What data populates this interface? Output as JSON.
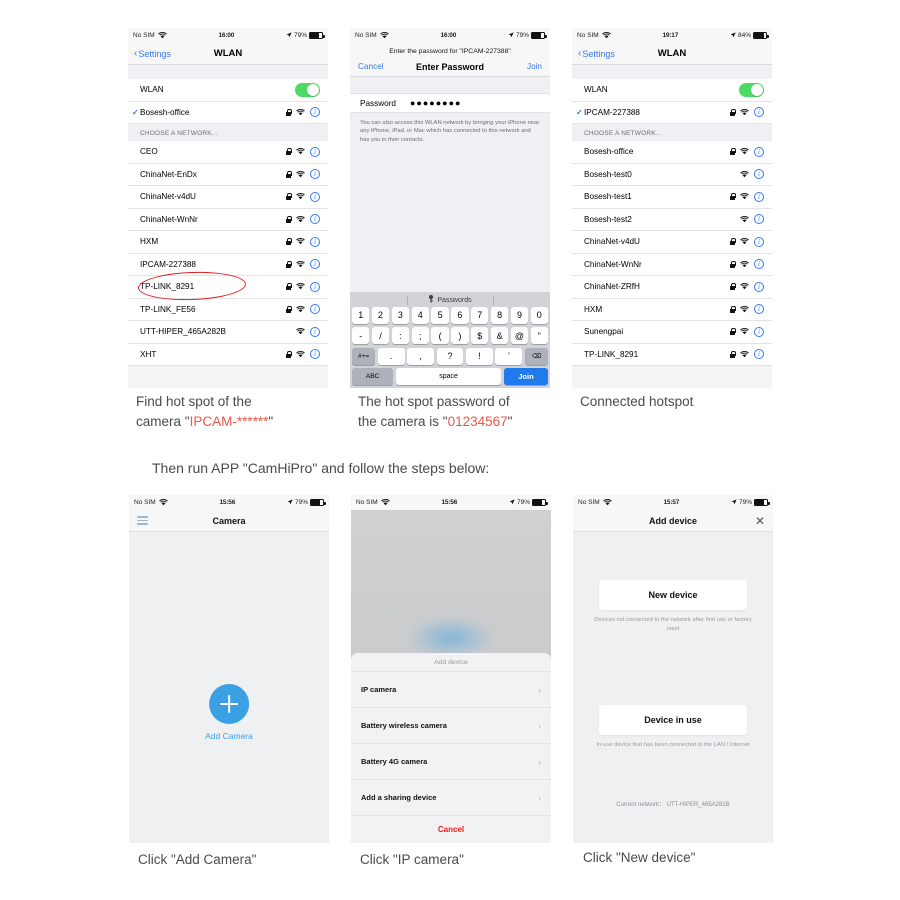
{
  "phones": {
    "wlan_list": {
      "statusbar": {
        "carrier": "No SIM",
        "time": "16:00",
        "battery_text": "79%"
      },
      "nav": {
        "back": "Settings",
        "title": "WLAN"
      },
      "wlan_row_label": "WLAN",
      "connected_network": "Bosesh-office",
      "section_header": "CHOOSE A NETWORK...",
      "networks": [
        {
          "name": "CEO",
          "locked": true
        },
        {
          "name": "ChinaNet-EnDx",
          "locked": true
        },
        {
          "name": "ChinaNet-v4dU",
          "locked": true
        },
        {
          "name": "ChinaNet-WnNr",
          "locked": true
        },
        {
          "name": "HXM",
          "locked": true
        },
        {
          "name": "IPCAM-227388",
          "locked": true
        },
        {
          "name": "TP-LINK_8291",
          "locked": true
        },
        {
          "name": "TP-LINK_FE56",
          "locked": true
        },
        {
          "name": "UTT-HIPER_465A282B",
          "locked": false
        },
        {
          "name": "XHT",
          "locked": true
        }
      ]
    },
    "password": {
      "statusbar": {
        "carrier": "No SIM",
        "time": "16:00",
        "battery_text": "79%"
      },
      "prompt": "Enter the password for \"IPCAM-227388\"",
      "bar": {
        "cancel": "Cancel",
        "title": "Enter Password",
        "join": "Join"
      },
      "field": {
        "label": "Password",
        "value": "●●●●●●●●"
      },
      "note": "You can also access this WLAN network by bringing your iPhone near any iPhone, iPad, or Mac which has connected to this network and has you in their contacts.",
      "keyboard": {
        "suggestion": "Passwords",
        "row1": [
          "1",
          "2",
          "3",
          "4",
          "5",
          "6",
          "7",
          "8",
          "9",
          "0"
        ],
        "row2": [
          "-",
          "/",
          ":",
          ";",
          "(",
          ")",
          "$",
          "&",
          "@",
          "”"
        ],
        "row3_left": "#+=",
        "row3": [
          ".",
          ",",
          "?",
          "!",
          "’"
        ],
        "row3_right": "⌫",
        "abc": "ABC",
        "space": "space",
        "join": "Join"
      }
    },
    "connected": {
      "statusbar": {
        "carrier": "No SIM",
        "time": "19:17",
        "battery_text": "84%"
      },
      "nav": {
        "back": "Settings",
        "title": "WLAN"
      },
      "wlan_row_label": "WLAN",
      "connected_network": "IPCAM-227388",
      "section_header": "CHOOSE A NETWORK...",
      "networks": [
        {
          "name": "Bosesh-office",
          "locked": true
        },
        {
          "name": "Bosesh-test0",
          "locked": false
        },
        {
          "name": "Bosesh-test1",
          "locked": true
        },
        {
          "name": "Bosesh-test2",
          "locked": false
        },
        {
          "name": "ChinaNet-v4dU",
          "locked": true
        },
        {
          "name": "ChinaNet-WnNr",
          "locked": true
        },
        {
          "name": "ChinaNet-ZRfH",
          "locked": true
        },
        {
          "name": "HXM",
          "locked": true
        },
        {
          "name": "Sunengpai",
          "locked": true
        },
        {
          "name": "TP-LINK_8291",
          "locked": true
        }
      ]
    },
    "camera_home": {
      "statusbar": {
        "carrier": "No SIM",
        "time": "15:56",
        "battery_text": "79%"
      },
      "nav_title": "Camera",
      "add_camera_label": "Add Camera"
    },
    "add_device_sheet": {
      "statusbar": {
        "carrier": "No SIM",
        "time": "15:56",
        "battery_text": "79%"
      },
      "sheet_title": "Add device",
      "items": [
        "IP camera",
        "Battery wireless camera",
        "Battery 4G camera",
        "Add a sharing device"
      ],
      "cancel": "Cancel"
    },
    "add_device": {
      "statusbar": {
        "carrier": "No SIM",
        "time": "15:57",
        "battery_text": "79%"
      },
      "nav_title": "Add device",
      "new_device": {
        "title": "New device",
        "subtitle": "Devices not connected to the network after first use or factory reset"
      },
      "device_in_use": {
        "title": "Device in use",
        "subtitle": "In-use device that has been connected to the LAN / Internet"
      },
      "current_network": "Current network： UTT-HIPER_465A282B"
    }
  },
  "captions": {
    "step1_a": "Find hot spot of the",
    "step1_b": "camera \"",
    "step1_hl": "IPCAM-******",
    "step1_c": "\"",
    "step2_a": "The hot spot password of",
    "step2_b": "the camera is \"",
    "step2_hl": "01234567",
    "step2_c": "\"",
    "step3": "Connected hotspot",
    "middle_line": "Then run APP \"CamHiPro\" and follow the steps below:",
    "step4": "Click \"Add Camera\"",
    "step5": "Click \"IP camera\"",
    "step6": "Click \"New device\""
  },
  "colors": {
    "accent_blue": "#3478f6",
    "toggle_green": "#4cd964",
    "highlight_red": "#e8594a",
    "annotation_red": "#e02020",
    "app_blue": "#3aa0e3",
    "cancel_red": "#e0211c"
  }
}
